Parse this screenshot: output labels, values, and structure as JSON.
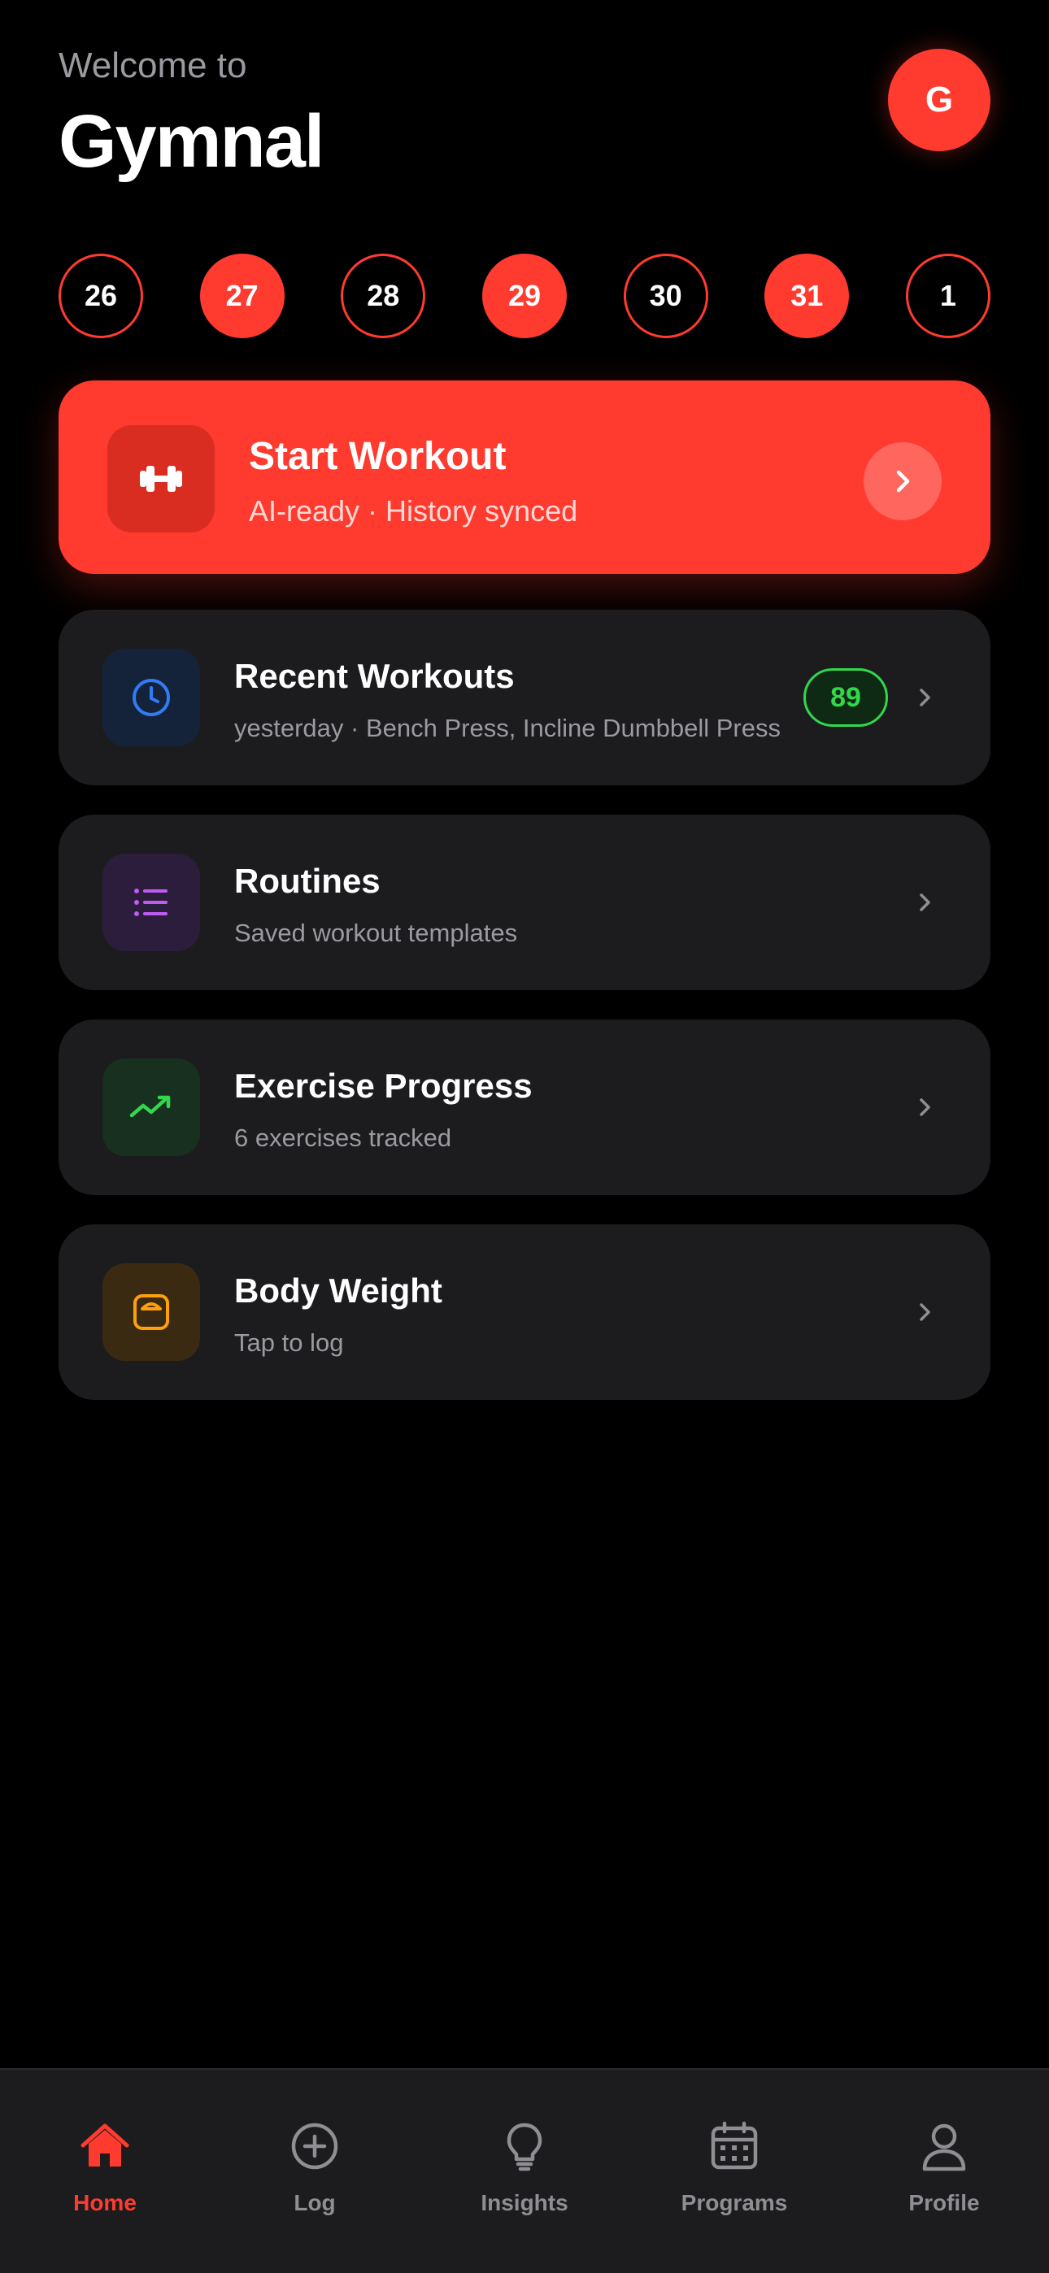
{
  "header": {
    "welcome": "Welcome to",
    "brand": "Gymnal",
    "avatar_initial": "G"
  },
  "days": [
    {
      "label": "26",
      "active": false
    },
    {
      "label": "27",
      "active": true
    },
    {
      "label": "28",
      "active": false
    },
    {
      "label": "29",
      "active": true
    },
    {
      "label": "30",
      "active": false
    },
    {
      "label": "31",
      "active": true
    },
    {
      "label": "1",
      "active": false
    }
  ],
  "start_workout": {
    "title": "Start Workout",
    "subtitle": "AI-ready · History synced",
    "icon": "dumbbell-icon"
  },
  "cards": [
    {
      "title": "Recent Workouts",
      "subtitle": "yesterday · Bench Press, Incline Dumbbell Press",
      "badge": "89",
      "icon": "clock-icon",
      "accent": "#2f7cf6"
    },
    {
      "title": "Routines",
      "subtitle": "Saved workout templates",
      "icon": "list-icon",
      "accent": "#bf5af2"
    },
    {
      "title": "Exercise Progress",
      "subtitle": "6 exercises tracked",
      "icon": "trend-icon",
      "accent": "#32d74b"
    },
    {
      "title": "Body Weight",
      "subtitle": "Tap to log",
      "icon": "scale-icon",
      "accent": "#ff9f0a"
    }
  ],
  "tabs": [
    {
      "label": "Home",
      "icon": "home-icon",
      "active": true
    },
    {
      "label": "Log",
      "icon": "plus-circle-icon",
      "active": false
    },
    {
      "label": "Insights",
      "icon": "lightbulb-icon",
      "active": false
    },
    {
      "label": "Programs",
      "icon": "calendar-icon",
      "active": false
    },
    {
      "label": "Profile",
      "icon": "person-icon",
      "active": false
    }
  ],
  "colors": {
    "accent": "#ff3b30",
    "card": "#1c1c1e",
    "background": "#000000",
    "badge_green": "#32d74b"
  }
}
